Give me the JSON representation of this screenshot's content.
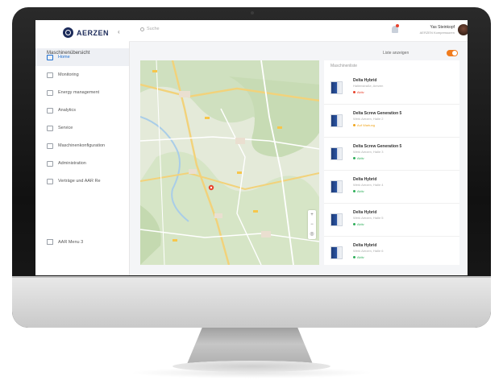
{
  "app": {
    "logo_text": "AERZEN",
    "search_placeholder": "Suche"
  },
  "user": {
    "name": "Yas Steinkopf",
    "role": "AERZEN Kompressoren"
  },
  "sidebar": {
    "items": [
      {
        "label": "Home",
        "active": true
      },
      {
        "label": "Monitoring"
      },
      {
        "label": "Energy management"
      },
      {
        "label": "Analytics"
      },
      {
        "label": "Service"
      },
      {
        "label": "Maschinenkonfiguration"
      },
      {
        "label": "Administration"
      },
      {
        "label": "Verträge und AAR Re"
      }
    ],
    "footer_label": "AAR Menu 3"
  },
  "main": {
    "title": "Maschinenübersicht",
    "toggle_label": "Liste anzeigen",
    "toggle_on": true,
    "panel_title": "Maschinenliste"
  },
  "machines": [
    {
      "name": "Delta Hybrid",
      "subtitle": "Hallenstraße, Aerzen",
      "status": "Aktiv",
      "status_color": "#e8412b"
    },
    {
      "name": "Delta Screw Generation 5",
      "subtitle": "Werk Aerzen, Halle 2",
      "status": "Auf Wartung",
      "status_color": "#f0a51d"
    },
    {
      "name": "Delta Screw Generation 5",
      "subtitle": "Werk Aerzen, Halle 3",
      "status": "Aktiv",
      "status_color": "#2eae5a"
    },
    {
      "name": "Delta Hybrid",
      "subtitle": "Werk Aerzen, Halle 4",
      "status": "Aktiv",
      "status_color": "#2eae5a"
    },
    {
      "name": "Delta Hybrid",
      "subtitle": "Werk Aerzen, Halle 5",
      "status": "Aktiv",
      "status_color": "#2eae5a"
    },
    {
      "name": "Delta Hybrid",
      "subtitle": "Werk Aerzen, Halle 6",
      "status": "Aktiv",
      "status_color": "#2eae5a"
    }
  ],
  "map": {
    "zoom_in": "+",
    "zoom_out": "−"
  },
  "colors": {
    "brand": "#1c2b5a",
    "accent": "#1f6fd0",
    "toggle": "#f07b1d"
  }
}
